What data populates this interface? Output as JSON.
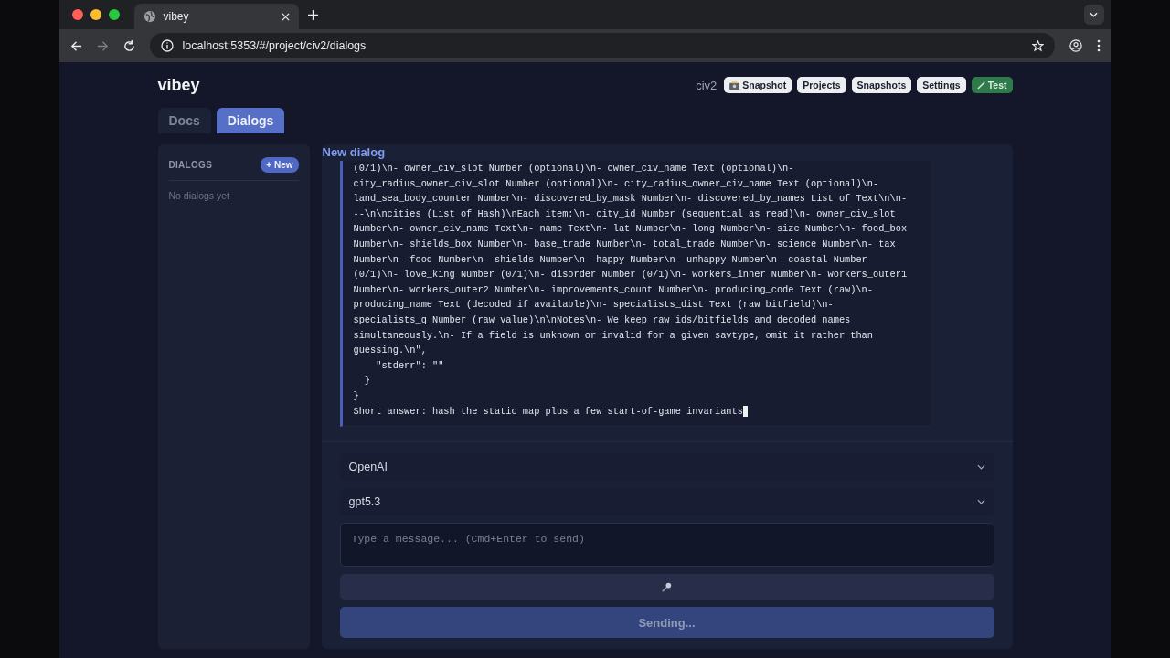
{
  "browser": {
    "tab": {
      "title": "vibey"
    },
    "url": "localhost:5353/#/project/civ2/dialogs"
  },
  "header": {
    "logo": "vibey",
    "project": "civ2",
    "buttons": [
      {
        "label": "Snapshot",
        "kind": "snapshot"
      },
      {
        "label": "Projects",
        "kind": "plain"
      },
      {
        "label": "Snapshots",
        "kind": "plain"
      },
      {
        "label": "Settings",
        "kind": "plain"
      },
      {
        "label": "Test",
        "kind": "test"
      }
    ]
  },
  "tabs": [
    {
      "label": "Docs",
      "selected": false
    },
    {
      "label": "Dialogs",
      "selected": true
    }
  ],
  "sidebar": {
    "heading": "DIALOGS",
    "new_button": "+ New",
    "empty": "No dialogs yet"
  },
  "dialog": {
    "title": "New dialog",
    "log_lines": [
      "(0/1)\\n- owner_civ_slot Number (optional)\\n- owner_civ_name Text (optional)\\n-",
      "city_radius_owner_civ_slot Number (optional)\\n- city_radius_owner_civ_name Text (optional)\\n-",
      "land_sea_body_counter Number\\n- discovered_by_mask Number\\n- discovered_by_names List of Text\\n\\n-",
      "--\\n\\ncities (List of Hash)\\nEach item:\\n- city_id Number (sequential as read)\\n- owner_civ_slot",
      "Number\\n- owner_civ_name Text\\n- name Text\\n- lat Number\\n- long Number\\n- size Number\\n- food_box",
      "Number\\n- shields_box Number\\n- base_trade Number\\n- total_trade Number\\n- science Number\\n- tax",
      "Number\\n- food Number\\n- shields Number\\n- happy Number\\n- unhappy Number\\n- coastal Number",
      "(0/1)\\n- love_king Number (0/1)\\n- disorder Number (0/1)\\n- workers_inner Number\\n- workers_outer1",
      "Number\\n- workers_outer2 Number\\n- improvements_count Number\\n- producing_code Text (raw)\\n-",
      "producing_name Text (decoded if available)\\n- specialists_dist Text (raw bitfield)\\n-",
      "specialists_q Number (raw value)\\n\\nNotes\\n- We keep raw ids/bitfields and decoded names",
      "simultaneously.\\n- If a field is unknown or invalid for a given savtype, omit it rather than",
      "guessing.\\n\",",
      "    \"stderr\": \"\"",
      "  }",
      "}",
      "Short answer: hash the static map plus a few start-of-game invariants"
    ],
    "provider": "OpenAI",
    "model": "gpt5.3",
    "message": {
      "placeholder": "Type a message... (Cmd+Enter to send)"
    },
    "send_button": {
      "label": "Sending...",
      "disabled": true
    }
  }
}
